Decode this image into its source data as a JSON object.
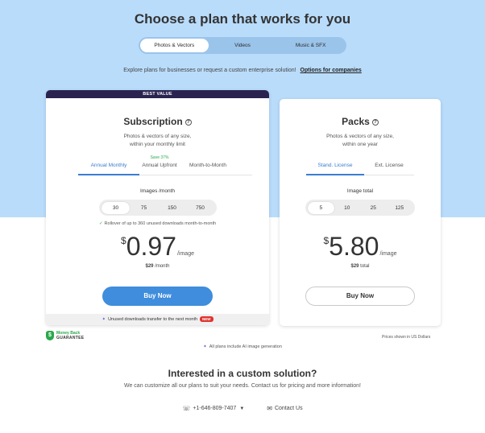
{
  "heading": "Choose a plan that works for you",
  "asset_tabs": [
    "Photos & Vectors",
    "Videos",
    "Music & SFX"
  ],
  "explore": {
    "text": "Explore plans for businesses or request a custom enterprise solution!",
    "link": "Options for companies"
  },
  "subscription": {
    "badge": "BEST VALUE",
    "title": "Subscription",
    "help_icon": "?",
    "desc_line1": "Photos & vectors of any size,",
    "desc_line2": "within your monthly limit",
    "tabs": [
      "Annual Monthly",
      "Annual Upfront",
      "Month-to-Month"
    ],
    "save_badge": "Save 37%",
    "qty_label": "Images /month",
    "qty_options": [
      "30",
      "75",
      "150",
      "750"
    ],
    "rollover": "Rollover of up to 360 unused downloads month-to-month",
    "currency": "$",
    "price": "0.97",
    "per": "/image",
    "sub_price_amount": "$29",
    "sub_price_unit": "/month",
    "button": "Buy Now",
    "unused_text": "Unused downloads transfer to the next month",
    "new_badge": "NEW"
  },
  "packs": {
    "title": "Packs",
    "help_icon": "?",
    "desc_line1": "Photos & vectors of any size,",
    "desc_line2": "within one year",
    "tabs": [
      "Stand. License",
      "Ext. License"
    ],
    "qty_label": "Image total",
    "qty_options": [
      "5",
      "10",
      "25",
      "125"
    ],
    "currency": "$",
    "price": "5.80",
    "per": "/image",
    "sub_price_amount": "$29",
    "sub_price_unit": "total",
    "button": "Buy Now"
  },
  "guarantee": {
    "line1": "Money Back",
    "line2": "GUARANTEE"
  },
  "prices_note": "Prices shown in US Dollars",
  "ai_note": "All plans include AI image generation",
  "custom": {
    "title": "Interested in a custom solution?",
    "subtitle": "We can customize all our plans to suit your needs. Contact us for pricing and more information!",
    "phone": "+1-646-809-7407",
    "contact": "Contact Us"
  },
  "colors": {
    "hero_bg": "#b9dcfb",
    "accent": "#3f8ddc",
    "badge_bg": "#2a2350",
    "green": "#2aa84a"
  }
}
